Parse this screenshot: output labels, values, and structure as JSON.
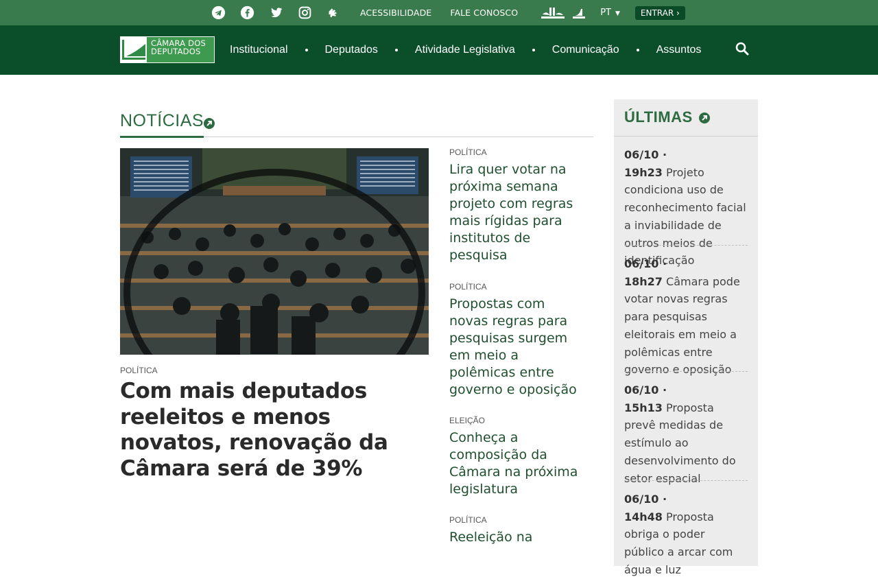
{
  "topbar": {
    "social": [
      "telegram-icon",
      "facebook-icon",
      "twitter-icon",
      "instagram-icon",
      "libras-icon"
    ],
    "accessibility": "ACESSIBILIDADE",
    "contact": "FALE CONOSCO",
    "language": "PT",
    "login": "ENTRAR"
  },
  "nav": {
    "logo_line1": "CÂMARA DOS",
    "logo_line2": "DEPUTADOS",
    "items": [
      "Institucional",
      "Deputados",
      "Atividade Legislativa",
      "Comunicação",
      "Assuntos"
    ]
  },
  "news": {
    "title": "NOTÍCIAS",
    "featured": {
      "category": "POLÍTICA",
      "title": "Com mais deputados reeleitos e menos novatos, renovação da Câmara será de 39%"
    },
    "side": [
      {
        "category": "POLÍTICA",
        "title": "Lira quer votar na próxima semana projeto com regras mais rígidas para institutos de pesquisa"
      },
      {
        "category": "POLÍTICA",
        "title": "Propostas com novas regras para pesquisas surgem em meio a polêmicas entre governo e oposição"
      },
      {
        "category": "ELEIÇÃO",
        "title": "Conheça a composição da Câmara na próxima legislatura"
      },
      {
        "category": "POLÍTICA",
        "title": "Reeleição na"
      }
    ]
  },
  "latest": {
    "title": "ÚLTIMAS",
    "items": [
      {
        "time": "06/10 · 19h23",
        "text": "Projeto condiciona uso de reconhecimento facial a inviabilidade de outros meios de identificação"
      },
      {
        "time": "06/10 · 18h27",
        "text": "Câmara pode votar novas regras para pesquisas eleitorais em meio a polêmicas entre governo e oposição"
      },
      {
        "time": "06/10 · 15h13",
        "text": "Proposta prevê medidas de estímulo ao desenvolvimento do setor espacial"
      },
      {
        "time": "06/10 · 14h48",
        "text": "Proposta obriga o poder público a arcar com água e luz"
      }
    ]
  },
  "colors": {
    "topbar": "#3a7b4e",
    "nav": "#0b4f2a",
    "accent": "#2d6b41"
  }
}
